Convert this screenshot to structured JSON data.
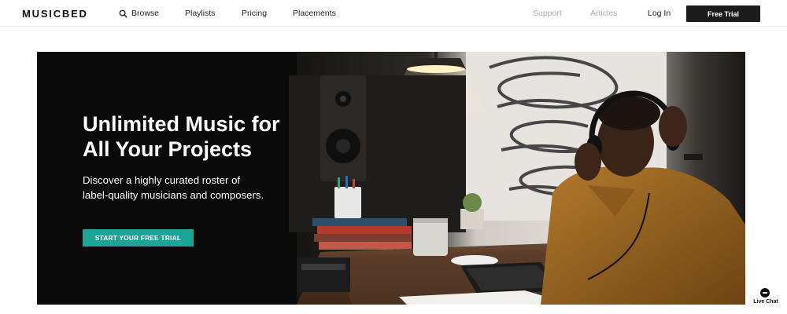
{
  "nav": {
    "logo": "MUSICBED",
    "browse": "Browse",
    "playlists": "Playlists",
    "pricing": "Pricing",
    "placements": "Placements",
    "support": "Support",
    "articles": "Articles",
    "login": "Log In",
    "free_trial": "Free Trial"
  },
  "hero": {
    "title_line1": "Unlimited Music for",
    "title_line2": "All Your Projects",
    "sub_line1": "Discover a highly curated roster of",
    "sub_line2": "label-quality musicians and composers.",
    "cta": "START YOUR FREE TRIAL"
  },
  "chat": {
    "label": "Live Chat"
  },
  "icons": [
    "search-icon",
    "chat-icon"
  ],
  "colors": {
    "accent": "#1aa596",
    "dark_button": "#1b1b1b"
  }
}
